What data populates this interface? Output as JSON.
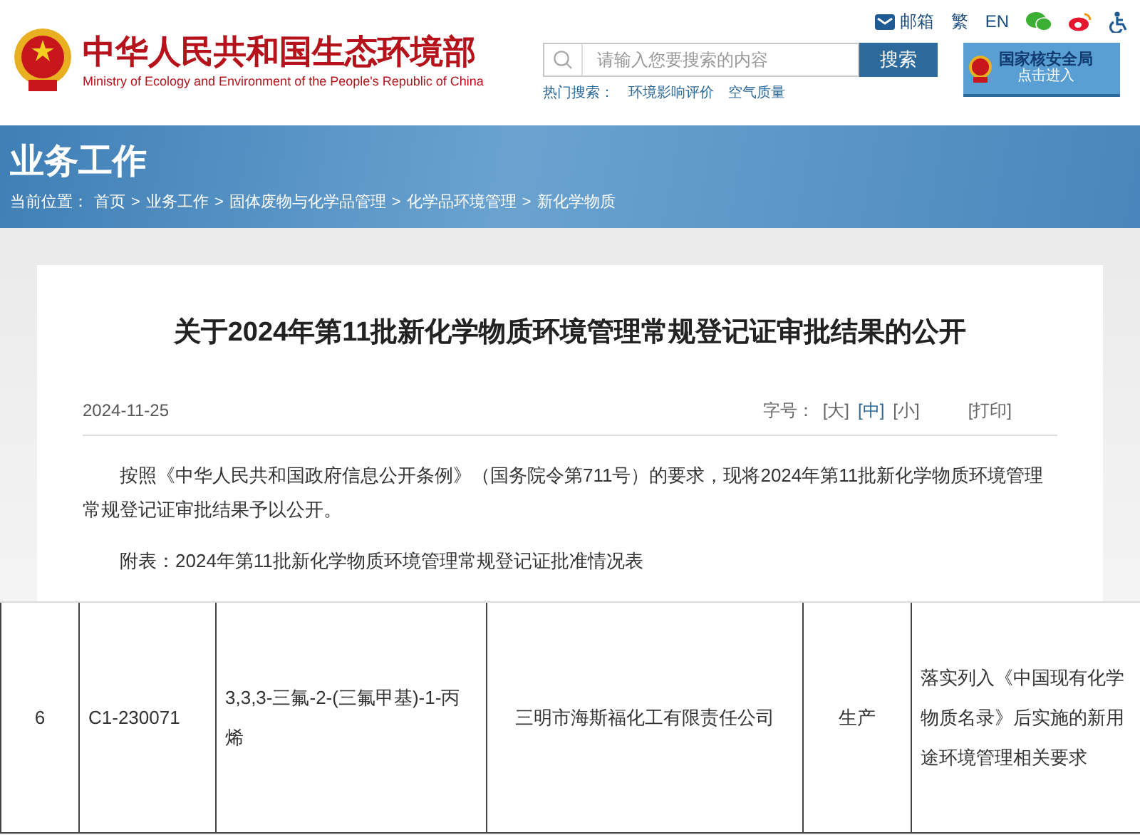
{
  "header": {
    "title": "中华人民共和国生态环境部",
    "subtitle": "Ministry of Ecology and Environment of the People's Republic of China",
    "top_links": [
      "邮箱",
      "繁",
      "EN"
    ],
    "search": {
      "placeholder": "请输入您要搜索的内容",
      "button": "搜索"
    },
    "hot_search": {
      "label": "热门搜索：",
      "items": [
        "环境影响评价",
        "空气质量"
      ]
    },
    "nnsa_banner": {
      "title": "国家核安全局",
      "link": "点击进入"
    }
  },
  "section": {
    "title": "业务工作",
    "breadcrumb_label": "当前位置：",
    "breadcrumb": [
      "首页",
      "业务工作",
      "固体废物与化学品管理",
      "化学品环境管理",
      "新化学物质"
    ],
    "separator": ">"
  },
  "article": {
    "title": "关于2024年第11批新化学物质环境管理常规登记证审批结果的公开",
    "date": "2024-11-25",
    "font_size_label": "字号：",
    "font_sizes": [
      {
        "label": "[大]",
        "selected": false
      },
      {
        "label": "[中]",
        "selected": true
      },
      {
        "label": "[小]",
        "selected": false
      }
    ],
    "print": "[打印]",
    "paragraphs": [
      "按照《中华人民共和国政府信息公开条例》（国务院令第711号）的要求，现将2024年第11批新化学物质环境管理常规登记证审批结果予以公开。",
      "附表：2024年第11批新化学物质环境管理常规登记证批准情况表"
    ]
  },
  "table": {
    "rows": [
      [
        "6",
        "C1-230071",
        "3,3,3-三氟-2-(三氟甲基)-1-丙烯",
        "三明市海斯福化工有限责任公司",
        "生产",
        "落实列入《中国现有化学物质名录》后实施的新用途环境管理相关要求"
      ]
    ]
  }
}
